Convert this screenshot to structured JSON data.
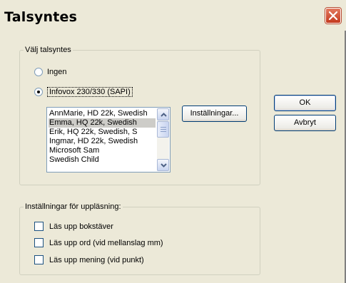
{
  "window": {
    "title": "Talsyntes"
  },
  "synth_group": {
    "legend": "Välj talsyntes",
    "options": [
      {
        "label": "Ingen",
        "checked": false
      },
      {
        "label": "Infovox 230/330 (SAPI)",
        "checked": true
      }
    ],
    "voices": [
      "AnnMarie, HD 22k, Swedish",
      "Emma, HQ 22k, Swedish",
      "Erik, HQ 22k, Swedish, S",
      "Ingmar, HD 22k, Swedish",
      "Microsoft Sam",
      "Swedish Child"
    ],
    "selected_voice": "Emma, HQ 22k, Swedish",
    "settings_button": "Inställningar..."
  },
  "buttons": {
    "ok": "OK",
    "cancel": "Avbryt"
  },
  "reading_group": {
    "legend": "Inställningar för uppläsning:",
    "checks": [
      {
        "label": "Läs upp bokstäver",
        "checked": false
      },
      {
        "label": "Läs upp ord (vid mellanslag mm)",
        "checked": false
      },
      {
        "label": "Läs upp mening (vid punkt)",
        "checked": false
      }
    ]
  }
}
